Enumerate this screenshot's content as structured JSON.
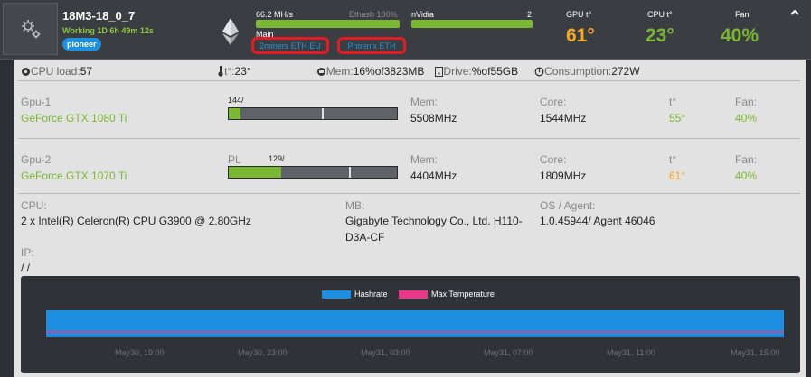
{
  "rig": {
    "name": "18M3-18_0_7",
    "status": "Working 1D 6h 49m 12s",
    "tag": "pioneer"
  },
  "miner": {
    "hashrate": "66.2 MH/s",
    "algo": "Ethash 100%",
    "label": "Main",
    "pools": [
      "2miners ETH EU",
      "Phoenix ETH"
    ]
  },
  "vendor": {
    "name": "nVidia",
    "count": "2"
  },
  "metrics": {
    "gpu_temp_label": "GPU t°",
    "gpu_temp": "61°",
    "cpu_temp_label": "CPU t°",
    "cpu_temp": "23°",
    "fan_label": "Fan",
    "fan": "40%"
  },
  "stats": {
    "cpu_load_label": "CPU load:",
    "cpu_load": "57",
    "temp_label": "t°:",
    "temp": "23°",
    "mem_label": "Mem:",
    "mem": "16%of3823MB",
    "drive_label": "Drive:",
    "drive": "%of55GB",
    "consumption_label": "Consumption:",
    "consumption": "272W"
  },
  "gpus": [
    {
      "id": "Gpu-1",
      "model": "GeForce GTX 1080 Ti",
      "pl_label": "PL",
      "pl_value": "144/",
      "mem_label": "Mem:",
      "mem": "5508MHz",
      "core_label": "Core:",
      "core": "1544MHz",
      "temp_label": "t°",
      "temp": "55°",
      "fan_label": "Fan:",
      "fan": "40%"
    },
    {
      "id": "Gpu-2",
      "model": "GeForce GTX 1070 Ti",
      "pl_label": "PL",
      "pl_value": "129/",
      "mem_label": "Mem:",
      "mem": "4404MHz",
      "core_label": "Core:",
      "core": "1809MHz",
      "temp_label": "t°",
      "temp": "61°",
      "fan_label": "Fan:",
      "fan": "40%"
    }
  ],
  "system": {
    "cpu_label": "CPU:",
    "cpu": "2 x Intel(R) Celeron(R) CPU G3900 @ 2.80GHz",
    "mb_label": "MB:",
    "mb_line1": "Gigabyte Technology Co., Ltd. H110-",
    "mb_line2": "D3A-CF",
    "os_label": "OS / Agent:",
    "os": "1.0.45944/ Agent 46046",
    "ip_label": "IP:",
    "ip": "/ /"
  },
  "chart_data": {
    "type": "area",
    "series": [
      {
        "name": "Hashrate",
        "color": "#1e8fe0",
        "values": [
          66.2,
          66.2,
          66.2,
          66.2,
          66.2,
          66.2,
          66.2,
          66.2,
          66.2,
          66.2,
          66.2,
          66.2
        ]
      },
      {
        "name": "Max Temperature",
        "color": "#e8388a",
        "values": [
          61,
          61,
          61,
          61,
          61,
          61,
          61,
          61,
          61,
          61,
          61,
          61
        ]
      }
    ],
    "legend": [
      "Hashrate",
      "Max Temperature"
    ],
    "x_ticks": [
      "May30, 19:00",
      "May30, 23:00",
      "May31, 03:00",
      "May31, 07:00",
      "May31, 11:00",
      "May31, 15:00"
    ],
    "legend_position": "top-center",
    "grid": false
  },
  "colors": {
    "accent_green": "#7ab733",
    "accent_orange": "#f5a623",
    "accent_blue": "#1e8fe0",
    "highlight_red": "#e51b24"
  }
}
